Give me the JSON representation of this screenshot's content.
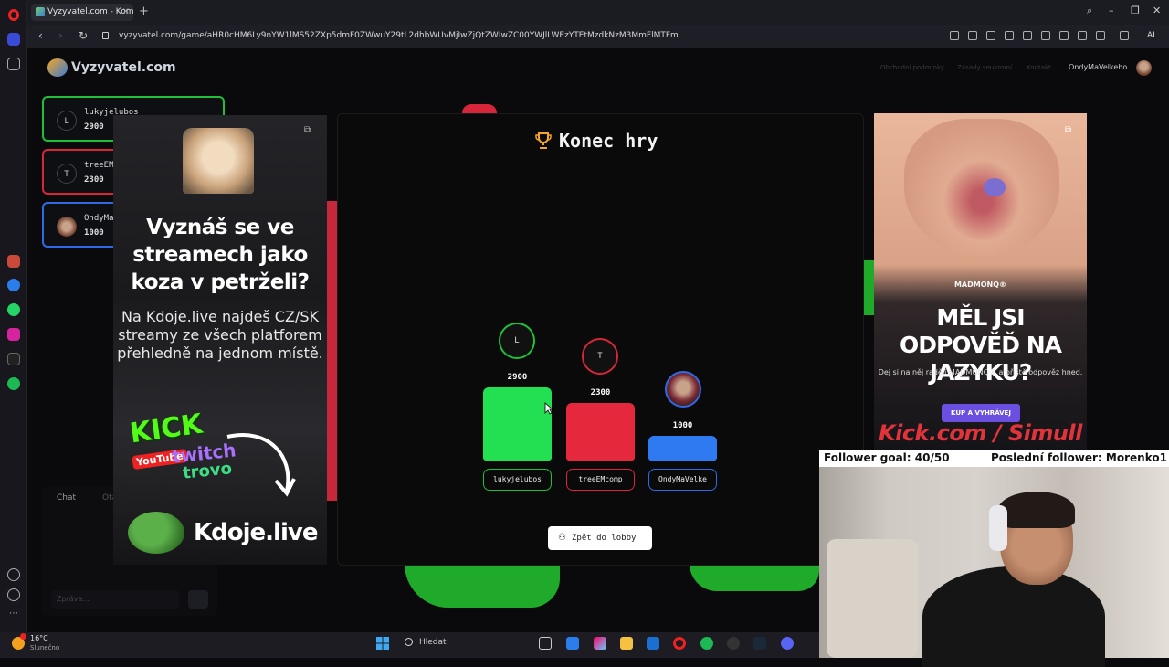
{
  "browser": {
    "tab_title": "Vyzyvatel.com - Komu",
    "url": "vyzyvatel.com/game/aHR0cHM6Ly9nYW1lMS52ZXp5dmF0ZWwuY29tL2dhbWUvMjIwZjQtZWIwZC00YWJlLWEzYTEtMzdkNzM3MmFlMTFm",
    "ai_label": "AI"
  },
  "site": {
    "title": "Vyzyvatel.com",
    "nav": [
      "Obchodní podmínky",
      "Zásady soukromí",
      "Kontakt"
    ],
    "username": "OndyMaVelkeho"
  },
  "players": [
    {
      "initial": "L",
      "name": "lukyjelubos",
      "score": "2900",
      "color": "#1fbf3a"
    },
    {
      "initial": "T",
      "name": "treeEM",
      "score": "2300",
      "color": "#d7263a"
    },
    {
      "initial": "",
      "name": "OndyMa",
      "score": "1000",
      "color": "#2e6ae6"
    }
  ],
  "chat": {
    "tab_chat": "Chat",
    "tab_questions": "Otázky",
    "input_placeholder": "Zpráva..."
  },
  "ad_left": {
    "headline": "Vyznáš se ve streamech jako koza v petrželi?",
    "body": "Na Kdoje.live najdeš CZ/SK streamy ze všech platforem přehledně na jednom místě.",
    "kick": "KICK",
    "youtube": "YouTube",
    "twitch": "twitch",
    "trovo": "trovo",
    "brand": "Kdoje.live"
  },
  "game": {
    "title": "Konec hry",
    "podium": [
      {
        "initial": "L",
        "name": "lukyjelubos",
        "score": "2900",
        "color": "#22e052",
        "border": "#1fbf3a"
      },
      {
        "initial": "T",
        "name": "treeEMcomp",
        "score": "2300",
        "color": "#e5283c",
        "border": "#d7263a"
      },
      {
        "initial": "",
        "name": "OndyMaVelke",
        "score": "1000",
        "color": "#2f7af0",
        "border": "#2e6ae6"
      }
    ],
    "back_button": "Zpět do lobby"
  },
  "ad_right": {
    "brand": "MADMONQ®",
    "headline": "MĚL JSI ODPOVĚĎ NA JAZYKU?",
    "body": "Dej si na něj raději MADMONQ® a příště odpověz hned.",
    "cta": "KUP A VYHRÁVEJ"
  },
  "stream_overlay": {
    "kick_banner": "Kick.com / Simull",
    "follower_goal": "Follower goal: 40/50",
    "last_follower": "Poslední follower: Morenko1"
  },
  "taskbar": {
    "temperature": "16°C",
    "weather": "Slunečno",
    "search": "Hledat"
  }
}
